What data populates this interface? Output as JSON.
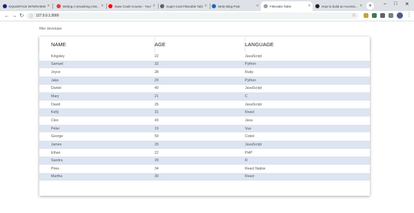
{
  "browser": {
    "tabs": [
      {
        "title": "EQUISPACE INTERVIEW SEI...",
        "favicon_color": "#1a237e",
        "active": false
      },
      {
        "title": "Writing A Smashing Artic...",
        "favicon_color": "#e53935",
        "active": false
      },
      {
        "title": "Sass Crash Course - YouT...",
        "favicon_color": "#ff0000",
        "active": false
      },
      {
        "title": "Super Cool Filterable Tabl...",
        "favicon_color": "#5f6368",
        "active": false
      },
      {
        "title": "Write Blog Post",
        "favicon_color": "#1565c0",
        "active": false
      },
      {
        "title": "Filterable Table",
        "favicon_color": "#9aa0a6",
        "active": true
      },
      {
        "title": "How to build an Accessi...",
        "favicon_color": "#202124",
        "active": false
      }
    ],
    "new_tab": "+",
    "window_controls": {
      "minimize": "–",
      "maximize": "□",
      "close": "✕"
    },
    "url": "127.0.0.1:3000",
    "nav_icons": {
      "back": "←",
      "forward": "→",
      "reload": "↻"
    },
    "icons": [
      "info-icon",
      "star-icon",
      "extension-icons",
      "profile-avatar",
      "menu-icon"
    ]
  },
  "filter": {
    "placeholder": "filter developer"
  },
  "table": {
    "headers": [
      "NAME",
      "AGE",
      "LANGUAGE"
    ],
    "rows": [
      [
        "Kingsley",
        "22",
        "JavaScript"
      ],
      [
        "Samuel",
        "32",
        "Python"
      ],
      [
        "Joyce",
        "28",
        "Ruby"
      ],
      [
        "Jake",
        "29",
        "Python"
      ],
      [
        "Daniel",
        "40",
        "JavaScript"
      ],
      [
        "Mary",
        "21",
        "C"
      ],
      [
        "David",
        "26",
        "JavaScript"
      ],
      [
        "Kelly",
        "31",
        "React"
      ],
      [
        "Cleo",
        "43",
        "Java"
      ],
      [
        "Peter",
        "19",
        "Vue"
      ],
      [
        "George",
        "59",
        "Cobol"
      ],
      [
        "James",
        "29",
        "JavaScript"
      ],
      [
        "Ethan",
        "22",
        "PHP"
      ],
      [
        "Sandra",
        "29",
        "R"
      ],
      [
        "Pires",
        "34",
        "React Native"
      ],
      [
        "Martha",
        "30",
        "React"
      ]
    ],
    "stripe_color": "#dce5f1"
  }
}
